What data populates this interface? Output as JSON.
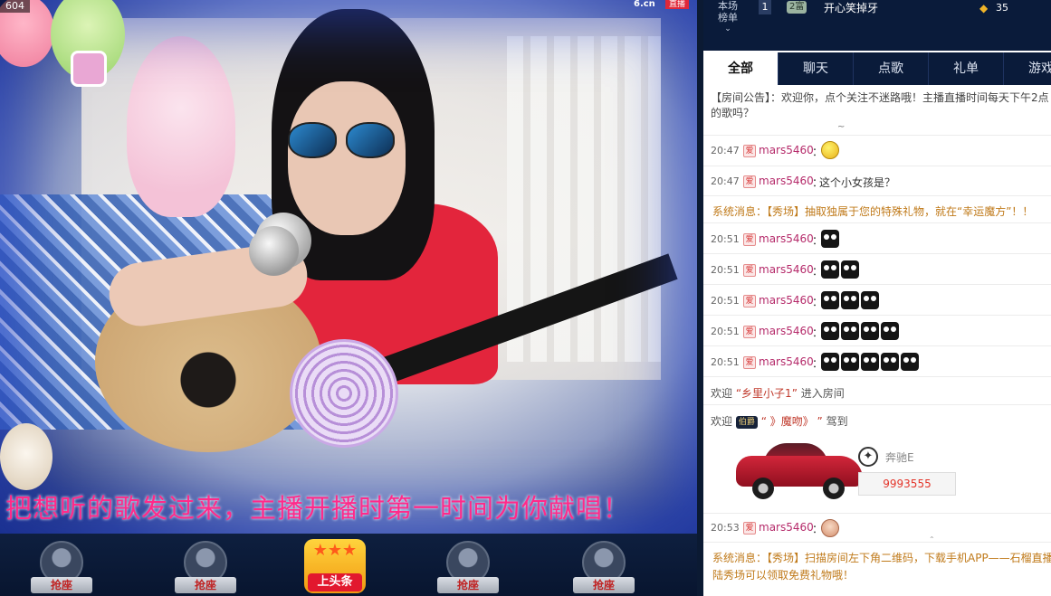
{
  "video": {
    "viewer_count": "604",
    "site_logo": "6.cn",
    "live_badge": "直播",
    "banner_text": "把想听的歌发过来，主播开播时第一时间为你献唱！"
  },
  "seats": [
    {
      "label": "抢座"
    },
    {
      "label": "抢座"
    },
    {
      "label": "上头条"
    },
    {
      "label": "抢座"
    },
    {
      "label": "抢座"
    }
  ],
  "rank": {
    "tab_line1": "本场",
    "tab_line2": "榜单",
    "rows": [
      {
        "rank": "1",
        "badge": "2富",
        "name": "开心笑掉牙",
        "score": "35"
      }
    ]
  },
  "tabs": [
    "全部",
    "聊天",
    "点歌",
    "礼单",
    "游戏"
  ],
  "chat": {
    "announcement": "【房间公告】：欢迎你，点个关注不迷路哦！主播直播时间每天下午2点",
    "announcement_line2": "的歌吗？",
    "messages": [
      {
        "time": "20:47",
        "badge": "爱",
        "user": "mars5460",
        "text": "",
        "emoji": "yellow",
        "emoji_count": 1
      },
      {
        "time": "20:47",
        "badge": "爱",
        "user": "mars5460",
        "text": "这个小女孩是？",
        "emoji": "",
        "emoji_count": 0
      },
      {
        "time": "20:51",
        "badge": "爱",
        "user": "mars5460",
        "text": "",
        "emoji": "black",
        "emoji_count": 1
      },
      {
        "time": "20:51",
        "badge": "爱",
        "user": "mars5460",
        "text": "",
        "emoji": "black",
        "emoji_count": 2
      },
      {
        "time": "20:51",
        "badge": "爱",
        "user": "mars5460",
        "text": "",
        "emoji": "black",
        "emoji_count": 3
      },
      {
        "time": "20:51",
        "badge": "爱",
        "user": "mars5460",
        "text": "",
        "emoji": "black",
        "emoji_count": 4
      },
      {
        "time": "20:51",
        "badge": "爱",
        "user": "mars5460",
        "text": "",
        "emoji": "black",
        "emoji_count": 5
      },
      {
        "time": "20:53",
        "badge": "爱",
        "user": "mars5460",
        "text": "",
        "emoji": "face",
        "emoji_count": 1
      }
    ],
    "system1": "系统消息：【秀场】抽取独属于您的特殊礼物，就在“幸运魔方”！！",
    "welcome_prefix": "欢迎",
    "welcome_user": "“乡里小子1”",
    "welcome_suffix": "进入房间",
    "drive_prefix": "欢迎",
    "drive_noble": "伯爵",
    "drive_user": "“ 》魔吻》 ”",
    "drive_suffix": "驾到",
    "car_name": "奔驰E",
    "car_price": "9993555",
    "system2_line1": "系统消息：【秀场】扫描房间左下角二维码，下载手机APP——石榴直播",
    "system2_line2": "陆秀场可以领取免费礼物哦！"
  }
}
